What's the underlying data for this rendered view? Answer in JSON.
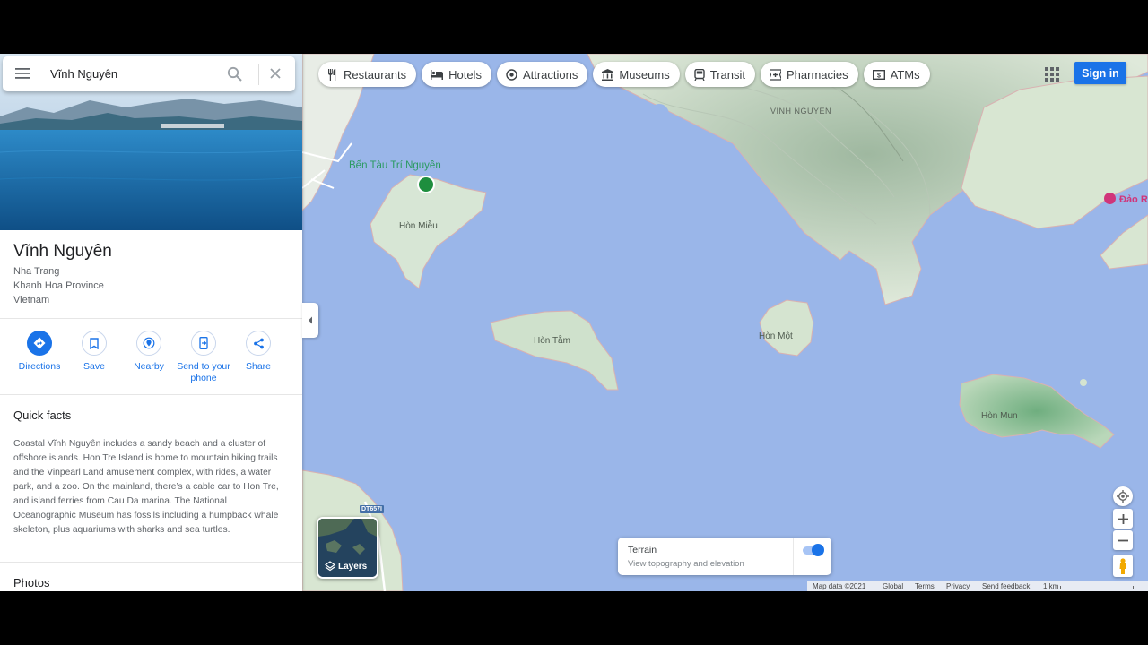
{
  "search": {
    "query": "Vĩnh Nguyên"
  },
  "place": {
    "title": "Vĩnh Nguyên",
    "address_lines": [
      "Nha Trang",
      "Khanh Hoa Province",
      "Vietnam"
    ]
  },
  "actions": [
    {
      "label": "Directions",
      "icon": "directions-icon"
    },
    {
      "label": "Save",
      "icon": "bookmark-icon"
    },
    {
      "label": "Nearby",
      "icon": "nearby-icon"
    },
    {
      "label": "Send to your phone",
      "icon": "send-to-phone-icon"
    },
    {
      "label": "Share",
      "icon": "share-icon"
    }
  ],
  "quick_facts": {
    "title": "Quick facts",
    "text": "Coastal Vĩnh Nguyên includes a sandy beach and a cluster of offshore islands. Hon Tre Island is home to mountain hiking trails and the Vinpearl Land amusement complex, with rides, a water park, and a zoo. On the mainland, there’s a cable car to Hon Tre, and island ferries from Cau Da marina. The National Oceanographic Museum has fossils including a humpback whale skeleton, plus aquariums with sharks and sea turtles."
  },
  "photos": {
    "title": "Photos"
  },
  "chips": [
    {
      "label": "Restaurants",
      "icon": "fork-knife-icon"
    },
    {
      "label": "Hotels",
      "icon": "bed-icon"
    },
    {
      "label": "Attractions",
      "icon": "camera-icon"
    },
    {
      "label": "Museums",
      "icon": "museum-icon"
    },
    {
      "label": "Transit",
      "icon": "train-icon"
    },
    {
      "label": "Pharmacies",
      "icon": "pharmacy-icon"
    },
    {
      "label": "ATMs",
      "icon": "atm-icon"
    }
  ],
  "header": {
    "sign_in": "Sign in"
  },
  "map": {
    "labels": {
      "district": "VĨNH NGUYÊN",
      "pier": "Bến Tàu Trí Nguyên",
      "hon_mieu": "Hòn Miễu",
      "hon_tam": "Hòn Tằm",
      "hon_mot": "Hòn Một",
      "hon_mun": "Hòn Mun",
      "poi_partial": "Đảo R",
      "road_badge": "DT657I"
    },
    "colors": {
      "water": "#9ab6e9",
      "land": "#d8e6d2",
      "forest": "#8fbf96"
    }
  },
  "layers": {
    "label": "Layers"
  },
  "terrain": {
    "title": "Terrain",
    "subtitle": "View topography and elevation",
    "enabled": true
  },
  "footer": {
    "map_data": "Map data ©2021",
    "global": "Global",
    "terms": "Terms",
    "privacy": "Privacy",
    "feedback": "Send feedback",
    "scale": "1 km"
  }
}
